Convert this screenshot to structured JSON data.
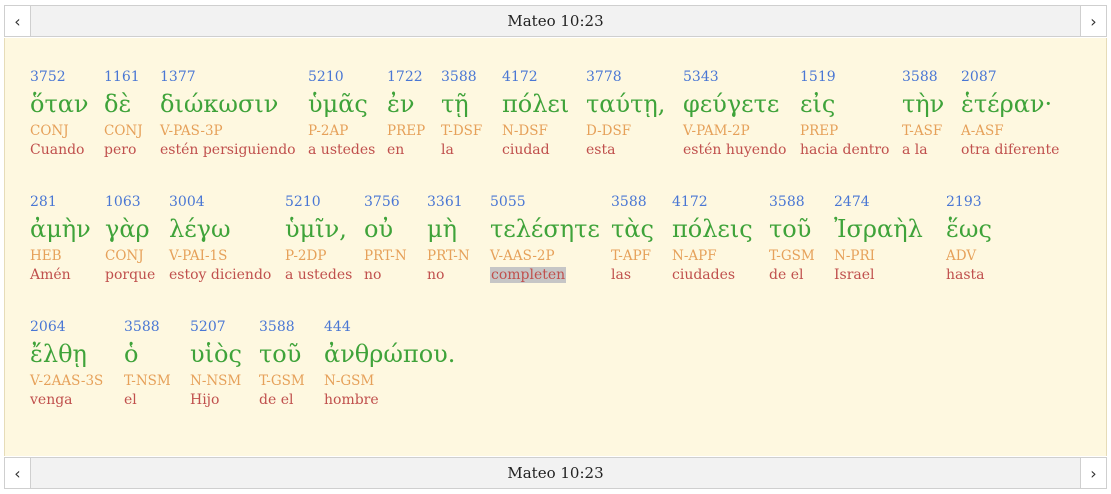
{
  "header": {
    "title": "Mateo 10:23",
    "prev_icon": "chevron-left-icon",
    "next_icon": "chevron-right-icon"
  },
  "footer": {
    "title": "Mateo 10:23"
  },
  "colors": {
    "strong": "#4a77d4",
    "greek": "#3fa33a",
    "morph": "#e6a15a",
    "gloss": "#c0504d",
    "background": "#fef8e0"
  },
  "words": [
    {
      "strong": "3752",
      "greek": "ὅταν",
      "morph": "CONJ",
      "gloss": "Cuando"
    },
    {
      "strong": "1161",
      "greek": "δὲ",
      "morph": "CONJ",
      "gloss": "pero"
    },
    {
      "strong": "1377",
      "greek": "διώκωσιν",
      "morph": "V-PAS-3P",
      "gloss": "estén persiguiendo"
    },
    {
      "strong": "5210",
      "greek": "ὑμᾶς",
      "morph": "P-2AP",
      "gloss": "a ustedes"
    },
    {
      "strong": "1722",
      "greek": "ἐν",
      "morph": "PREP",
      "gloss": "en"
    },
    {
      "strong": "3588",
      "greek": "τῇ",
      "morph": "T-DSF",
      "gloss": "la"
    },
    {
      "strong": "4172",
      "greek": "πόλει",
      "morph": "N-DSF",
      "gloss": "ciudad"
    },
    {
      "strong": "3778",
      "greek": "ταύτῃ,",
      "morph": "D-DSF",
      "gloss": "esta"
    },
    {
      "strong": "5343",
      "greek": "φεύγετε",
      "morph": "V-PAM-2P",
      "gloss": "estén huyendo"
    },
    {
      "strong": "1519",
      "greek": "εἰς",
      "morph": "PREP",
      "gloss": "hacia dentro"
    },
    {
      "strong": "3588",
      "greek": "τὴν",
      "morph": "T-ASF",
      "gloss": "a la"
    },
    {
      "strong": "2087",
      "greek": "ἑτέραν·",
      "morph": "A-ASF",
      "gloss": "otra diferente"
    },
    {
      "strong": "281",
      "greek": "ἀμὴν",
      "morph": "HEB",
      "gloss": "Amén"
    },
    {
      "strong": "1063",
      "greek": "γὰρ",
      "morph": "CONJ",
      "gloss": "porque"
    },
    {
      "strong": "3004",
      "greek": "λέγω",
      "morph": "V-PAI-1S",
      "gloss": "estoy diciendo"
    },
    {
      "strong": "5210",
      "greek": "ὑμῖν,",
      "morph": "P-2DP",
      "gloss": "a ustedes"
    },
    {
      "strong": "3756",
      "greek": "οὐ",
      "morph": "PRT-N",
      "gloss": "no"
    },
    {
      "strong": "3361",
      "greek": "μὴ",
      "morph": "PRT-N",
      "gloss": "no"
    },
    {
      "strong": "5055",
      "greek": "τελέσητε",
      "morph": "V-AAS-2P",
      "gloss": "completen",
      "highlighted": true
    },
    {
      "strong": "3588",
      "greek": "τὰς",
      "morph": "T-APF",
      "gloss": "las"
    },
    {
      "strong": "4172",
      "greek": "πόλεις",
      "morph": "N-APF",
      "gloss": "ciudades"
    },
    {
      "strong": "3588",
      "greek": "τοῦ",
      "morph": "T-GSM",
      "gloss": "de el"
    },
    {
      "strong": "2474",
      "greek": "Ἰσραὴλ",
      "morph": "N-PRI",
      "gloss": "Israel"
    },
    {
      "strong": "2193",
      "greek": "ἕως",
      "morph": "ADV",
      "gloss": "hasta"
    },
    {
      "strong": "2064",
      "greek": "ἔλθῃ",
      "morph": "V-2AAS-3S",
      "gloss": "venga"
    },
    {
      "strong": "3588",
      "greek": "ὁ",
      "morph": "T-NSM",
      "gloss": "el"
    },
    {
      "strong": "5207",
      "greek": "υἱὸς",
      "morph": "N-NSM",
      "gloss": "Hijo"
    },
    {
      "strong": "3588",
      "greek": "τοῦ",
      "morph": "T-GSM",
      "gloss": "de el"
    },
    {
      "strong": "444",
      "greek": "ἀνθρώπου.",
      "morph": "N-GSM",
      "gloss": "hombre"
    }
  ]
}
